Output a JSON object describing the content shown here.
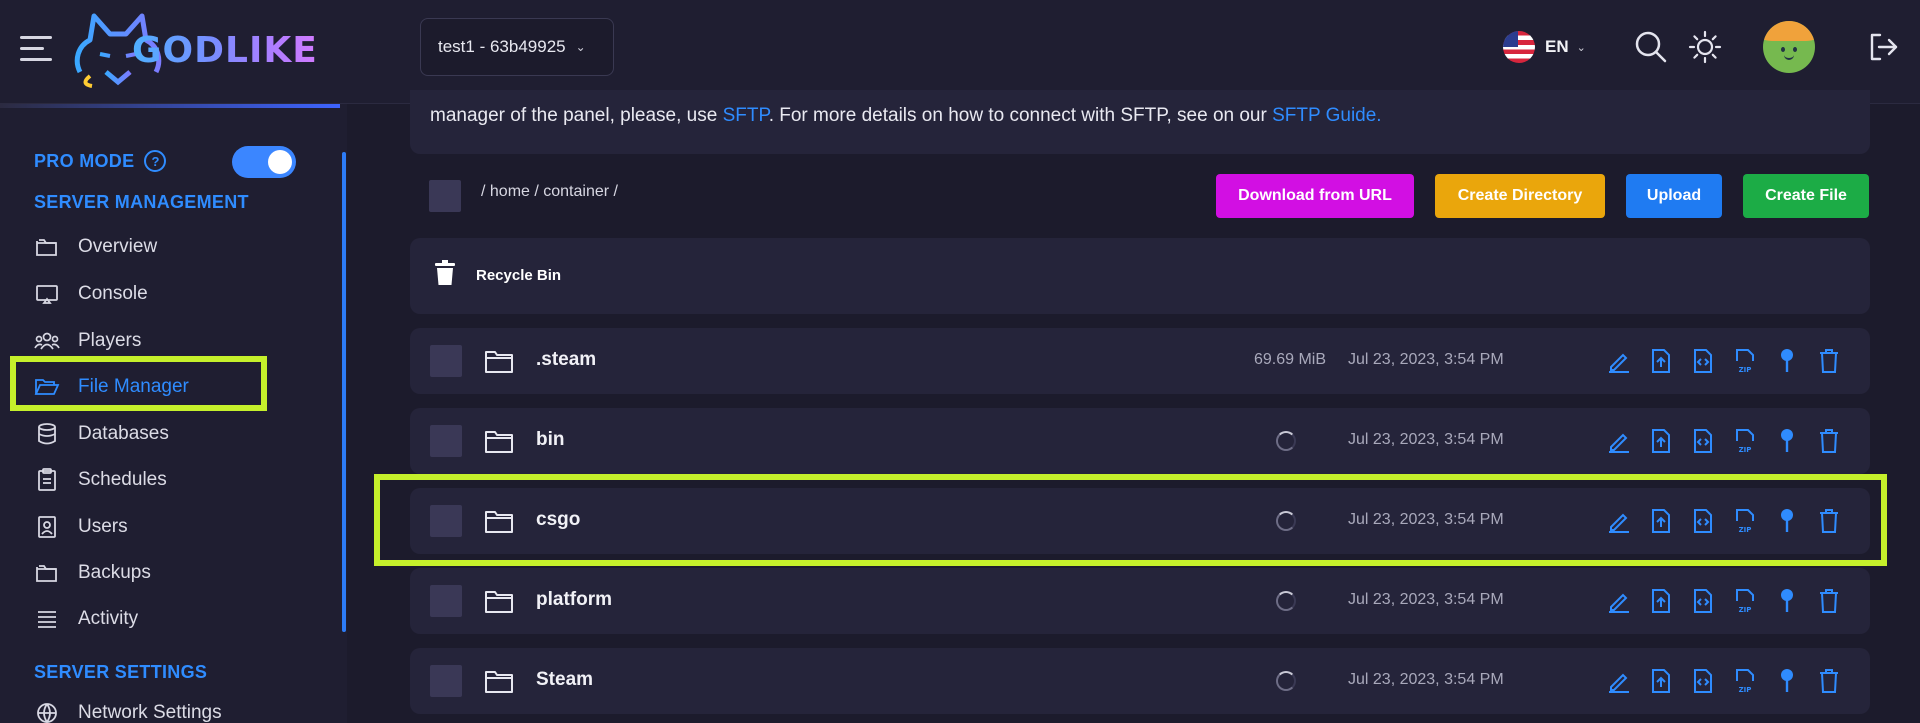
{
  "header": {
    "logo_text": "GODLIKE",
    "server_select": "test1 - 63b49925",
    "language": "EN"
  },
  "sidebar": {
    "pro_mode": "PRO MODE",
    "pro_help": "?",
    "pro_enabled": true,
    "section_management": "SERVER MANAGEMENT",
    "items": [
      {
        "label": "Overview",
        "icon": "folder-icon"
      },
      {
        "label": "Console",
        "icon": "monitor-icon"
      },
      {
        "label": "Players",
        "icon": "users-group-icon"
      },
      {
        "label": "File Manager",
        "icon": "folder-open-icon",
        "active": true
      },
      {
        "label": "Databases",
        "icon": "database-icon"
      },
      {
        "label": "Schedules",
        "icon": "clipboard-icon"
      },
      {
        "label": "Users",
        "icon": "user-badge-icon"
      },
      {
        "label": "Backups",
        "icon": "folder-icon"
      },
      {
        "label": "Activity",
        "icon": "list-icon"
      }
    ],
    "section_settings": "SERVER SETTINGS",
    "settings_items": [
      {
        "label": "Network Settings",
        "icon": "globe-icon"
      }
    ]
  },
  "main": {
    "info": {
      "text_a": "manager of the panel, please, use ",
      "link_sftp": "SFTP",
      "text_b": ". For more details on how to connect with SFTP, see on our ",
      "link_guide": "SFTP Guide."
    },
    "breadcrumb": "/ home / container /",
    "buttons": {
      "download_url": "Download from URL",
      "create_directory": "Create Directory",
      "upload": "Upload",
      "create_file": "Create File"
    },
    "button_colors": {
      "download_url": "#d20fe3",
      "create_directory": "#eaa60c",
      "upload": "#1f7bf2",
      "create_file": "#1cac46"
    },
    "recycle_bin": "Recycle Bin",
    "files": [
      {
        "name": ".steam",
        "size": "69.69 MiB",
        "date": "Jul 23, 2023, 3:54 PM"
      },
      {
        "name": "bin",
        "size": "",
        "date": "Jul 23, 2023, 3:54 PM"
      },
      {
        "name": "csgo",
        "size": "",
        "date": "Jul 23, 2023, 3:54 PM"
      },
      {
        "name": "platform",
        "size": "",
        "date": "Jul 23, 2023, 3:54 PM"
      },
      {
        "name": "Steam",
        "size": "",
        "date": "Jul 23, 2023, 3:54 PM"
      }
    ],
    "row_actions": [
      "rename-icon",
      "move-icon",
      "edit-code-icon",
      "archive-zip-icon",
      "pin-icon",
      "trash-icon"
    ]
  },
  "colors": {
    "accent": "#2f8cff",
    "highlight": "#c5f02b"
  }
}
